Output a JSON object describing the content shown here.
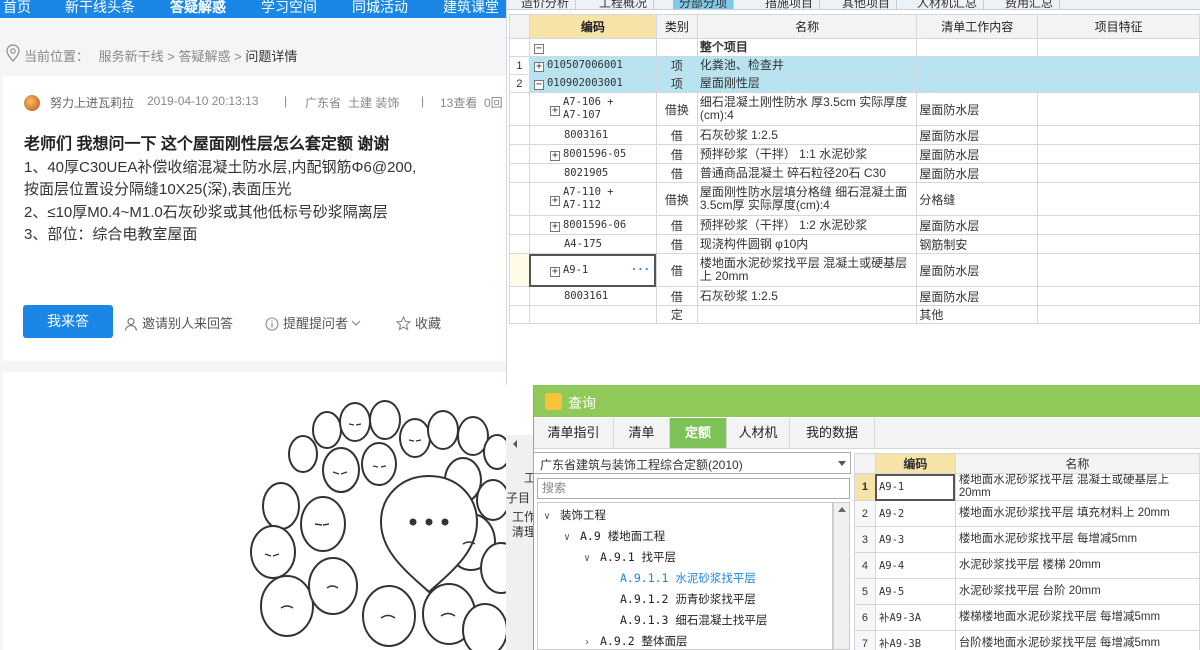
{
  "web": {
    "nav": [
      {
        "label": "首页",
        "active": false
      },
      {
        "label": "新干线头条",
        "active": false
      },
      {
        "label": "答疑解惑",
        "active": true
      },
      {
        "label": "学习空间",
        "active": false
      },
      {
        "label": "同城活动",
        "active": false
      },
      {
        "label": "建筑课堂",
        "active": false
      }
    ],
    "breadcrumb": {
      "prefix": "当前位置：",
      "path1": "服务新干线",
      "sep": ">",
      "path2": "答疑解惑",
      "current": "问题详情"
    },
    "question": {
      "author": "努力上进瓦莉拉",
      "datetime": "2019-04-10 20:13:13",
      "divider": "|",
      "region": "广东省",
      "category": "土建 装饰",
      "views": "13查看",
      "answers": "0回",
      "title": "老师们 我想问一下 这个屋面刚性层怎么套定额 谢谢",
      "lines": [
        "1、40厚C30UEA补偿收缩混凝土防水层,内配钢筋Φ6@200,",
        "按面层位置设分隔缝10X25(深),表面压光",
        "2、≤10厚M0.4~M1.0石灰砂浆或其他低标号砂浆隔离层",
        "3、部位：综合电教室屋面"
      ],
      "answer_button": "我来答",
      "invite_label": "邀请别人来回答",
      "remind_label": "提醒提问者",
      "collect_label": "收藏"
    }
  },
  "grid": {
    "tabs": [
      "造价分析",
      "工程概况",
      "分部分项",
      "措施项目",
      "其他项目",
      "人材机汇总",
      "费用汇总"
    ],
    "headers": {
      "code": "编码",
      "type": "类别",
      "name": "名称",
      "work": "清单工作内容",
      "feature": "项目特征"
    },
    "rows": [
      {
        "rn": "",
        "box": "−",
        "code": "",
        "type": "",
        "name": "整个项目",
        "work": "",
        "feature": "",
        "bold": true,
        "hl": false
      },
      {
        "rn": "1",
        "box": "+",
        "code": "010507006001",
        "type": "项",
        "name": "化粪池、检查井",
        "work": "",
        "feature": "",
        "hl": true
      },
      {
        "rn": "2",
        "box": "−",
        "code": "010902003001",
        "type": "项",
        "name": "屋面刚性层",
        "work": "",
        "feature": "",
        "hl": true
      },
      {
        "rn": "",
        "box": "+",
        "code": "A7-106 +\nA7-107",
        "type": "借换",
        "name": "细石混凝土刚性防水 厚3.5cm  实际厚度(cm):4",
        "work": "屋面防水层",
        "feature": ""
      },
      {
        "rn": "",
        "box": "",
        "code": "8003161",
        "type": "借",
        "name": "石灰砂浆 1:2.5",
        "work": "屋面防水层",
        "feature": ""
      },
      {
        "rn": "",
        "box": "+",
        "code": "8001596-05",
        "type": "借",
        "name": "预拌砂浆（干拌） 1:1 水泥砂浆",
        "work": "屋面防水层",
        "feature": ""
      },
      {
        "rn": "",
        "box": "",
        "code": "8021905",
        "type": "借",
        "name": "普通商品混凝土 碎石粒径20石 C30",
        "work": "屋面防水层",
        "feature": ""
      },
      {
        "rn": "",
        "box": "+",
        "code": "A7-110 +\nA7-112",
        "type": "借换",
        "name": "屋面刚性防水层填分格缝 细石混凝土面3.5cm厚  实际厚度(cm):4",
        "work": "分格缝",
        "feature": ""
      },
      {
        "rn": "",
        "box": "+",
        "code": "8001596-06",
        "type": "借",
        "name": "预拌砂浆（干拌） 1:2 水泥砂浆",
        "work": "屋面防水层",
        "feature": ""
      },
      {
        "rn": "",
        "box": "",
        "code": "A4-175",
        "type": "借",
        "name": "现浇构件圆钢 φ10内",
        "work": "钢筋制安",
        "feature": ""
      },
      {
        "rn": "",
        "box": "+",
        "code": "A9-1",
        "type": "借",
        "name": "楼地面水泥砂浆找平层 混凝土或硬基层上 20mm",
        "work": "屋面防水层",
        "feature": "",
        "selected": true
      },
      {
        "rn": "",
        "box": "",
        "code": "8003161",
        "type": "借",
        "name": "石灰砂浆 1:2.5",
        "work": "屋面防水层",
        "feature": ""
      },
      {
        "rn": "",
        "box": "",
        "code": "",
        "type": "定",
        "name": "",
        "work": "其他",
        "feature": ""
      }
    ],
    "ellipsis": "···"
  },
  "dialog": {
    "title": "查询",
    "tabs": [
      {
        "label": "清单指引",
        "active": false
      },
      {
        "label": "清单",
        "active": false
      },
      {
        "label": "定额",
        "active": true
      },
      {
        "label": "人材机",
        "active": false
      },
      {
        "label": "我的数据",
        "active": false
      }
    ],
    "quota_db": "广东省建筑与装饰工程综合定额(2010)",
    "search_placeholder": "搜索",
    "tree": [
      {
        "label": "装饰工程",
        "level": 0,
        "chev": "v",
        "active": false
      },
      {
        "label": "A.9 楼地面工程",
        "level": 1,
        "chev": "v",
        "active": false
      },
      {
        "label": "A.9.1 找平层",
        "level": 2,
        "chev": "v",
        "active": false
      },
      {
        "label": "A.9.1.1 水泥砂浆找平层",
        "level": 3,
        "chev": "",
        "active": true
      },
      {
        "label": "A.9.1.2 沥青砂浆找平层",
        "level": 3,
        "chev": "",
        "active": false
      },
      {
        "label": "A.9.1.3 细石混凝土找平层",
        "level": 3,
        "chev": "",
        "active": false
      },
      {
        "label": "A.9.2 整体面层",
        "level": 2,
        "chev": ">",
        "active": false
      }
    ],
    "strip_texts": [
      "工",
      "子目",
      "工作",
      "清理"
    ],
    "result_headers": {
      "code": "编码",
      "name": "名称"
    },
    "results": [
      {
        "rn": "1",
        "code": "A9-1",
        "name": "楼地面水泥砂浆找平层 混凝土或硬基层上 20mm",
        "current": true
      },
      {
        "rn": "2",
        "code": "A9-2",
        "name": "楼地面水泥砂浆找平层 填充材料上 20mm"
      },
      {
        "rn": "3",
        "code": "A9-3",
        "name": "楼地面水泥砂浆找平层 每增减5mm"
      },
      {
        "rn": "4",
        "code": "A9-4",
        "name": "水泥砂浆找平层 楼梯 20mm"
      },
      {
        "rn": "5",
        "code": "A9-5",
        "name": "水泥砂浆找平层 台阶 20mm"
      },
      {
        "rn": "6",
        "code": "补A9-3A",
        "name": "楼梯楼地面水泥砂浆找平层 每增减5mm"
      },
      {
        "rn": "7",
        "code": "补A9-3B",
        "name": "台阶楼地面水泥砂浆找平层 每增减5mm"
      }
    ]
  },
  "colors": {
    "brand_blue": "#1a86e6",
    "row_highlight": "#b8e4f1",
    "dialog_green": "#8fc95a",
    "tab_green": "#7cc257",
    "header_yellow": "#f6e3a8"
  }
}
